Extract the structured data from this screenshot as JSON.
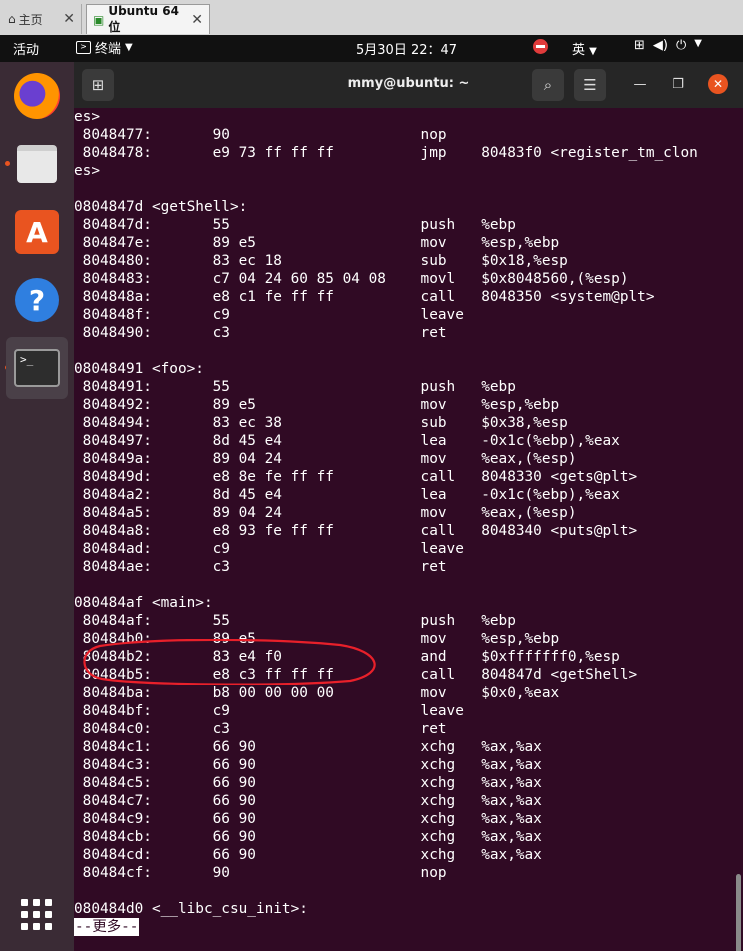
{
  "vm_tabs": [
    {
      "label": "主页",
      "icon": "home-icon"
    },
    {
      "label": "Ubuntu 64 位",
      "icon": "vm-icon"
    }
  ],
  "topbar": {
    "activities": "活动",
    "app_name": "终端",
    "clock": "5月30日  22：47",
    "input_method": "英"
  },
  "terminal": {
    "title": "mmy@ubuntu: ~",
    "lines": [
      "es>",
      " 8048477:       90                      nop",
      " 8048478:       e9 73 ff ff ff          jmp    80483f0 <register_tm_clon",
      "es>",
      "",
      "0804847d <getShell>:",
      " 804847d:       55                      push   %ebp",
      " 804847e:       89 e5                   mov    %esp,%ebp",
      " 8048480:       83 ec 18                sub    $0x18,%esp",
      " 8048483:       c7 04 24 60 85 04 08    movl   $0x8048560,(%esp)",
      " 804848a:       e8 c1 fe ff ff          call   8048350 <system@plt>",
      " 804848f:       c9                      leave",
      " 8048490:       c3                      ret",
      "",
      "08048491 <foo>:",
      " 8048491:       55                      push   %ebp",
      " 8048492:       89 e5                   mov    %esp,%ebp",
      " 8048494:       83 ec 38                sub    $0x38,%esp",
      " 8048497:       8d 45 e4                lea    -0x1c(%ebp),%eax",
      " 804849a:       89 04 24                mov    %eax,(%esp)",
      " 804849d:       e8 8e fe ff ff          call   8048330 <gets@plt>",
      " 80484a2:       8d 45 e4                lea    -0x1c(%ebp),%eax",
      " 80484a5:       89 04 24                mov    %eax,(%esp)",
      " 80484a8:       e8 93 fe ff ff          call   8048340 <puts@plt>",
      " 80484ad:       c9                      leave",
      " 80484ae:       c3                      ret",
      "",
      "080484af <main>:",
      " 80484af:       55                      push   %ebp",
      " 80484b0:       89 e5                   mov    %esp,%ebp",
      " 80484b2:       83 e4 f0                and    $0xfffffff0,%esp",
      " 80484b5:       e8 c3 ff ff ff          call   804847d <getShell>",
      " 80484ba:       b8 00 00 00 00          mov    $0x0,%eax",
      " 80484bf:       c9                      leave",
      " 80484c0:       c3                      ret",
      " 80484c1:       66 90                   xchg   %ax,%ax",
      " 80484c3:       66 90                   xchg   %ax,%ax",
      " 80484c5:       66 90                   xchg   %ax,%ax",
      " 80484c7:       66 90                   xchg   %ax,%ax",
      " 80484c9:       66 90                   xchg   %ax,%ax",
      " 80484cb:       66 90                   xchg   %ax,%ax",
      " 80484cd:       66 90                   xchg   %ax,%ax",
      " 80484cf:       90                      nop",
      "",
      "080484d0 <__libc_csu_init>:"
    ],
    "more_prompt": "--更多--"
  },
  "dock": {
    "items": [
      "firefox-icon",
      "files-icon",
      "software-store-icon",
      "help-icon",
      "terminal-icon"
    ],
    "accent": "#e95420"
  },
  "colors": {
    "terminal_bg": "#300a24",
    "annotation": "#e8202a"
  }
}
